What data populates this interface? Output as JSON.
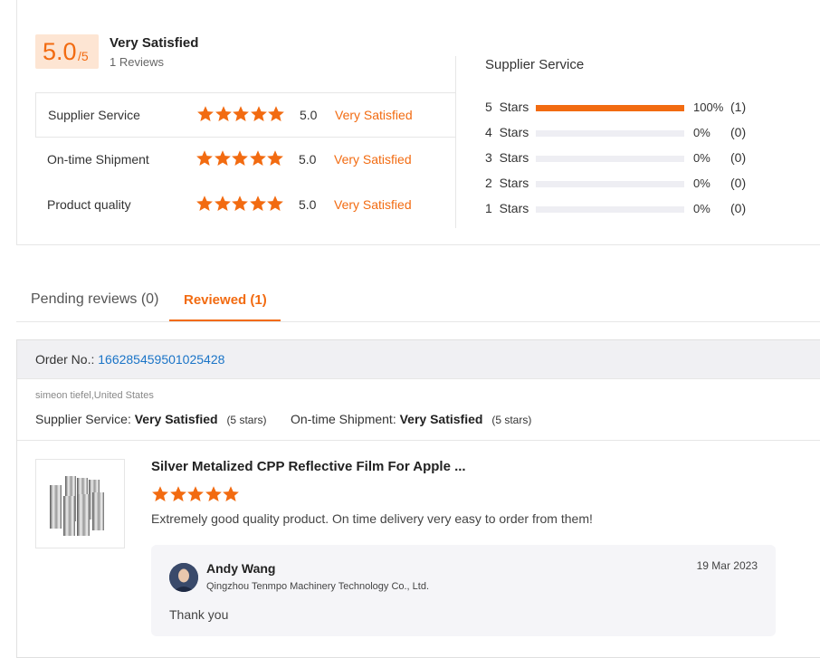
{
  "summary": {
    "score": "5.0",
    "score_denominator": "/5",
    "overall_label": "Very Satisfied",
    "review_count": "1 Reviews",
    "accent_color": "#f26b11",
    "rows": [
      {
        "label": "Supplier Service",
        "stars": 5,
        "score": "5.0",
        "verdict": "Very Satisfied"
      },
      {
        "label": "On-time Shipment",
        "stars": 5,
        "score": "5.0",
        "verdict": "Very Satisfied"
      },
      {
        "label": "Product quality",
        "stars": 5,
        "score": "5.0",
        "verdict": "Very Satisfied"
      }
    ]
  },
  "distribution": {
    "title": "Supplier Service",
    "rows": [
      {
        "label": "5  Stars",
        "fraction": 1.0,
        "pct": "100%",
        "count": "(1)"
      },
      {
        "label": "4  Stars",
        "fraction": 0.0,
        "pct": "0%",
        "count": "(0)"
      },
      {
        "label": "3  Stars",
        "fraction": 0.0,
        "pct": "0%",
        "count": "(0)"
      },
      {
        "label": "2  Stars",
        "fraction": 0.0,
        "pct": "0%",
        "count": "(0)"
      },
      {
        "label": "1  Stars",
        "fraction": 0.0,
        "pct": "0%",
        "count": "(0)"
      }
    ]
  },
  "tabs": [
    {
      "label": "Pending reviews (0)",
      "active": false
    },
    {
      "label": "Reviewed (1)",
      "active": true
    }
  ],
  "order": {
    "order_no_label": "Order No.:",
    "order_no": "166285459501025428",
    "reviewer": "simeon tiefel,United States",
    "supplier_service_label": "Supplier Service:",
    "supplier_service_value": "Very Satisfied",
    "supplier_service_stars": "(5 stars)",
    "shipment_label": "On-time Shipment:",
    "shipment_value": "Very Satisfied",
    "shipment_stars": "(5 stars)",
    "product_title": "Silver Metalized CPP Reflective Film For Apple ...",
    "review_stars": 5,
    "review_text": "Extremely good quality product. On time delivery very easy to order from them!",
    "reply": {
      "name": "Andy Wang",
      "company": "Qingzhou Tenmpo Machinery Technology Co., Ltd.",
      "date": "19 Mar 2023",
      "text": "Thank you"
    }
  }
}
